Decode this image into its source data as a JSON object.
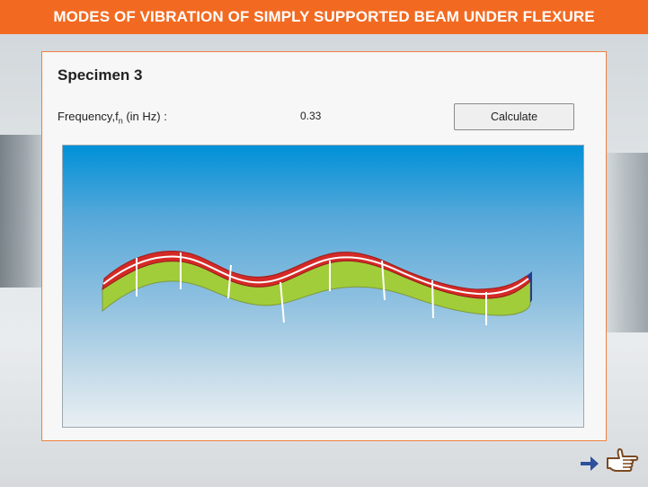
{
  "header": {
    "title": "MODES OF VIBRATION OF SIMPLY SUPPORTED BEAM UNDER FLEXURE"
  },
  "panel": {
    "specimen_title": "Specimen 3",
    "frequency_label_prefix": "Frequency,f",
    "frequency_label_sub": "n",
    "frequency_label_suffix": " (in Hz) :",
    "frequency_value": "0.33",
    "calculate_label": "Calculate"
  },
  "simulation": {
    "beam_top_color": "#d42a27",
    "beam_side_color": "#a2cd3a",
    "end_cap_color": "#2d3a8c"
  },
  "navigation": {
    "next_icon": "arrow-right-icon",
    "hand_icon": "pointing-hand-icon",
    "arrow_color": "#2d4f9c",
    "hand_color": "#7a4a22"
  }
}
